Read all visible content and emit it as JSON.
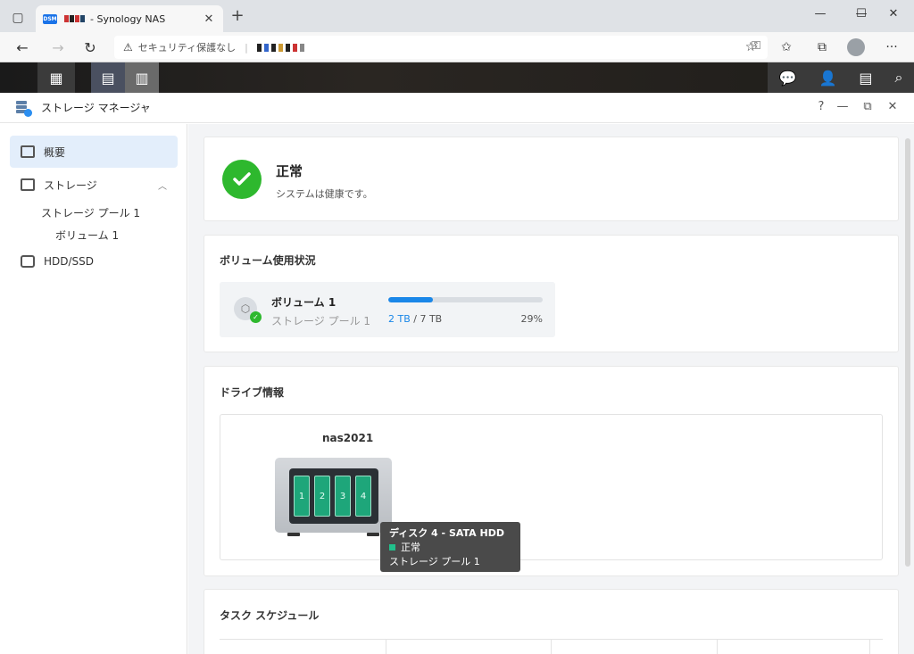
{
  "browser": {
    "tab_title": "- Synology NAS",
    "favicon_text": "DSM",
    "security_warning": "セキュリティ保護なし",
    "window_controls": [
      "minimize",
      "maximize",
      "close"
    ]
  },
  "app": {
    "title": "ストレージ マネージャ"
  },
  "sidebar": {
    "overview": "概要",
    "storage": "ストレージ",
    "storage_pool": "ストレージ プール 1",
    "volume": "ボリューム 1",
    "hdd": "HDD/SSD"
  },
  "status": {
    "title": "正常",
    "subtitle": "システムは健康です。",
    "color": "#2eb82e"
  },
  "volume_usage": {
    "title": "ボリューム使用状況",
    "volume_name": "ボリューム 1",
    "pool": "ストレージ プール 1",
    "used": "2 TB",
    "separator": " / ",
    "total": "7 TB",
    "percent_label": "29%",
    "percent": 29,
    "bar_color": "#1a87e8"
  },
  "drive_info": {
    "title": "ドライブ情報",
    "nas_name": "nas2021",
    "bays": [
      "1",
      "2",
      "3",
      "4"
    ],
    "tooltip": {
      "title": "ディスク 4 - SATA HDD",
      "status": "正常",
      "pool": "ストレージ プール 1"
    }
  },
  "task_schedule": {
    "title": "タスク スケジュール"
  }
}
